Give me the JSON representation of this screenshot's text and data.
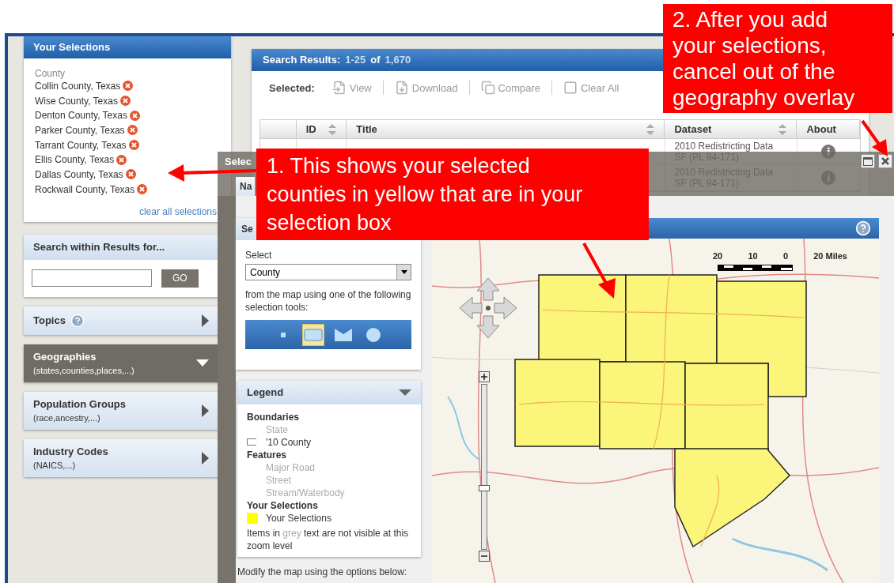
{
  "selections": {
    "title": "Your Selections",
    "category": "County",
    "items": [
      {
        "name": "Collin County, Texas"
      },
      {
        "name": "Wise County, Texas"
      },
      {
        "name": "Denton County, Texas"
      },
      {
        "name": "Parker County, Texas"
      },
      {
        "name": "Tarrant County, Texas"
      },
      {
        "name": "Ellis County, Texas"
      },
      {
        "name": "Dallas County, Texas"
      },
      {
        "name": "Rockwall County, Texas"
      }
    ],
    "clear_link": "clear all selections"
  },
  "search": {
    "title": "Search within Results for...",
    "button": "GO"
  },
  "sections": [
    {
      "title": "Topics",
      "help": true,
      "expanded": false
    },
    {
      "title": "Geographies",
      "subtitle": "(states,counties,places,...)",
      "help": false,
      "expanded": true
    },
    {
      "title": "Population Groups",
      "subtitle": "(race,ancestry,...)",
      "help": false,
      "expanded": false
    },
    {
      "title": "Industry Codes",
      "subtitle": "(NAICS,...)",
      "help": false,
      "expanded": false
    }
  ],
  "results": {
    "title": "Search Results:",
    "range": "1-25",
    "of": "of",
    "total": "1,670",
    "selected_label": "Selected:",
    "actions": [
      {
        "label": "View",
        "kind": "view",
        "disabled": true
      },
      {
        "label": "Download",
        "kind": "download",
        "disabled": true
      },
      {
        "label": "Compare",
        "kind": "compare",
        "disabled": true
      },
      {
        "label": "Clear All",
        "kind": "clear",
        "disabled": true
      }
    ],
    "columns": [
      {
        "label": "ID",
        "sortable": true
      },
      {
        "label": "Title",
        "sortable": true
      },
      {
        "label": "Dataset",
        "sortable": true
      },
      {
        "label": "About",
        "sortable": false
      }
    ],
    "rows": [
      {
        "dataset": "2010 Redistricting Data SF (PL 94-171)"
      },
      {
        "dataset": "2010 Redistricting Data SF (PL 94-171)"
      }
    ]
  },
  "dialog": {
    "title": "Selec",
    "tab": "Na",
    "window_buttons": [
      {
        "kind": "maximize"
      },
      {
        "kind": "close"
      }
    ]
  },
  "select_panel": {
    "title": "Se",
    "select_label": "Select",
    "dropdown_value": "County",
    "instructions": "from the map using one of the following selection tools:",
    "tools": [
      {
        "kind": "point",
        "selected": false
      },
      {
        "kind": "rectangle",
        "selected": true
      },
      {
        "kind": "polygon",
        "selected": false
      },
      {
        "kind": "circle",
        "selected": false
      }
    ]
  },
  "legend": {
    "title": "Legend",
    "expanded": true,
    "entries": [
      {
        "kind": "heading",
        "label": "Boundaries"
      },
      {
        "kind": "item",
        "label": "State",
        "visible": false
      },
      {
        "kind": "outline_item",
        "label": "'10 County",
        "visible": true
      },
      {
        "kind": "heading",
        "label": "Features"
      },
      {
        "kind": "item",
        "label": "Major Road",
        "visible": false
      },
      {
        "kind": "item",
        "label": "Street",
        "visible": false
      },
      {
        "kind": "item",
        "label": "Stream/Waterbody",
        "visible": false
      },
      {
        "kind": "heading",
        "label": "Your Selections"
      },
      {
        "kind": "fill_item",
        "label": "Your Selections",
        "visible": true
      }
    ],
    "note": [
      "Items in ",
      "grey",
      " text are not visible at this zoom level"
    ]
  },
  "modify_text": "Modify the map using the options below:",
  "map": {
    "scale_labels": [
      "20",
      "10",
      "0",
      "20 Miles"
    ],
    "zoom": {
      "level": 0.37
    }
  },
  "annotations": [
    {
      "lines": [
        "1. This shows your selected",
        "counties in yellow that are in your",
        "selection box"
      ]
    },
    {
      "lines": [
        "2. After you add",
        "your selections,",
        "cancel out of the",
        "geography overlay"
      ]
    }
  ]
}
